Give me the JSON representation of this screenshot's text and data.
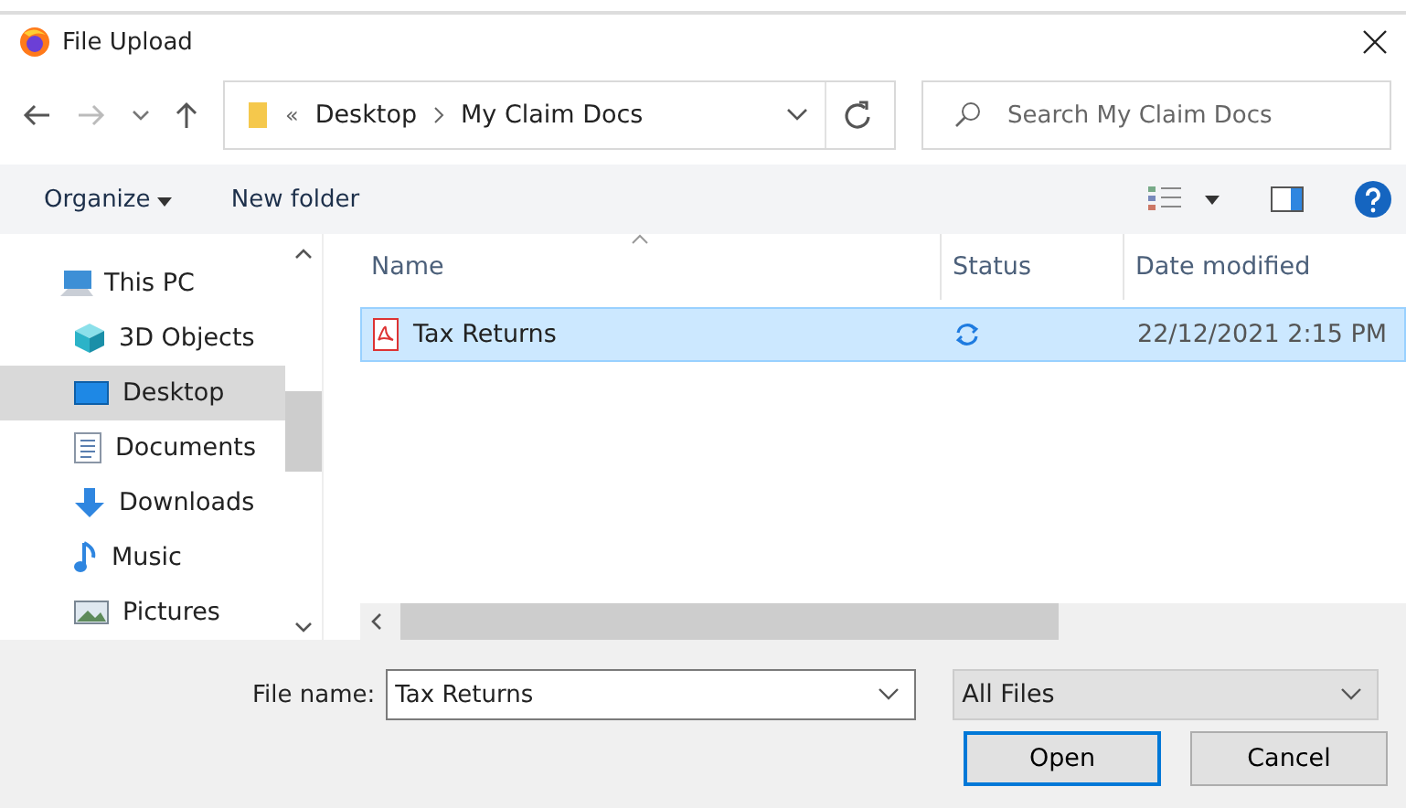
{
  "window": {
    "title": "File Upload"
  },
  "address": {
    "overflow": "«",
    "crumbs": [
      "Desktop",
      "My Claim Docs"
    ]
  },
  "search": {
    "placeholder": "Search My Claim Docs"
  },
  "toolbar": {
    "organize": "Organize",
    "new_folder": "New folder"
  },
  "sidebar": {
    "items": [
      {
        "label": "This PC",
        "kind": "pc",
        "selected": false,
        "children": [
          {
            "label": "3D Objects",
            "kind": "cube",
            "selected": false
          },
          {
            "label": "Desktop",
            "kind": "desktop",
            "selected": true
          },
          {
            "label": "Documents",
            "kind": "docs",
            "selected": false
          },
          {
            "label": "Downloads",
            "kind": "download",
            "selected": false
          },
          {
            "label": "Music",
            "kind": "music",
            "selected": false
          },
          {
            "label": "Pictures",
            "kind": "pictures",
            "selected": false
          }
        ]
      }
    ]
  },
  "table": {
    "columns": [
      "Name",
      "Status",
      "Date modified"
    ],
    "rows": [
      {
        "name": "Tax Returns",
        "date": "22/12/2021 2:15 PM",
        "selected": true
      }
    ]
  },
  "file_name": {
    "label": "File name:",
    "value": "Tax Returns"
  },
  "file_type": {
    "value": "All Files"
  },
  "buttons": [
    "Open",
    "Cancel"
  ]
}
